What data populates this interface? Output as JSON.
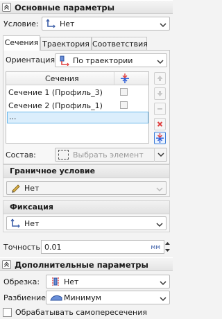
{
  "main_section": {
    "title": "Основные параметры",
    "condition": {
      "label": "Условие:",
      "value": "Нет"
    },
    "tabs": [
      {
        "label": "Сечения",
        "active": true
      },
      {
        "label": "Траектория",
        "active": false
      },
      {
        "label": "Соответствия",
        "active": false
      }
    ],
    "orientation": {
      "label": "Ориентация:",
      "value": "По траектории"
    },
    "sections_table": {
      "header": "Сечения",
      "rows": [
        {
          "name": "Сечение 1 (Профиль_3)",
          "checked": false
        },
        {
          "name": "Сечение 2 (Профиль_1)",
          "checked": false
        },
        {
          "name": "...",
          "selected": true
        }
      ]
    },
    "composition": {
      "label": "Состав:",
      "placeholder": "Выбрать элемент"
    },
    "boundary_condition": {
      "title": "Граничное условие",
      "value": "Нет"
    },
    "fixation": {
      "title": "Фиксация",
      "value": "Нет"
    },
    "accuracy": {
      "label": "Точность:",
      "value": "0.01",
      "unit": "мм"
    }
  },
  "extra_section": {
    "title": "Дополнительные параметры",
    "trim": {
      "label": "Обрезка:",
      "value": "Нет"
    },
    "split": {
      "label": "Разбиение:",
      "value": "Минимум"
    },
    "self_intersection": {
      "label": "Обрабатывать самопересечения",
      "checked": false
    }
  },
  "colors": {
    "accent_red": "#e04040",
    "accent_blue": "#2a5bd7",
    "selection": "#dbeefc"
  }
}
